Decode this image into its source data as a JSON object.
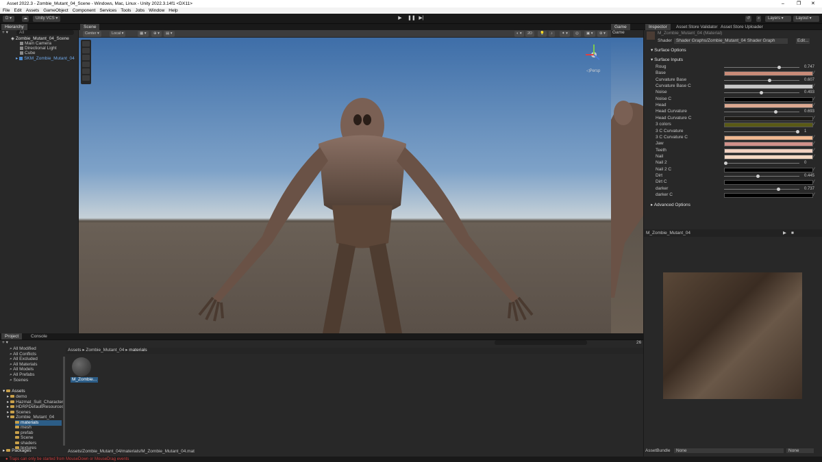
{
  "window": {
    "title": "Asset 2022.3 - Zombie_Mutant_04_Scene - Windows, Mac, Linux - Unity 2022.3.14f1 <DX11>"
  },
  "menu": [
    "File",
    "Edit",
    "Assets",
    "GameObject",
    "Component",
    "Services",
    "Tools",
    "Jobs",
    "Window",
    "Help"
  ],
  "toolbar": {
    "account": "D",
    "vcs": "Unity VCS",
    "layers": "Layers",
    "layout": "Layout"
  },
  "hierarchy": {
    "tab": "Hierarchy",
    "search_placeholder": "All",
    "scene": "Zombie_Mutant_04_Scene",
    "items": [
      "Main Camera",
      "Directional Light",
      "Cube",
      "SKM_Zombie_Mutant_04"
    ]
  },
  "scene": {
    "tab": "Scene",
    "pivot": "Center",
    "space": "Local",
    "persp": "Persp",
    "mode": "2D"
  },
  "game": {
    "tab": "Game",
    "display": "Game"
  },
  "inspector": {
    "tabs": [
      "Inspector",
      "Asset Store Validator",
      "Asset Store Uploader"
    ],
    "material": "M_Zombie_Mutant_04 (Material)",
    "shader_label": "Shader",
    "shader": "Shader Graphs/Zombie_Mutant_04 Shader Graph",
    "edit": "Edit...",
    "surface_options": "Surface Options",
    "surface_inputs": "Surface Inputs",
    "advanced": "Advanced Options",
    "props": [
      {
        "name": "Roug",
        "type": "slider",
        "value": "0.747",
        "v": 0.747
      },
      {
        "name": "Base",
        "type": "color",
        "color": "#c98b78"
      },
      {
        "name": "Curvature Base",
        "type": "slider",
        "value": "0.607",
        "v": 0.607
      },
      {
        "name": "Curvature Base C",
        "type": "color",
        "color": "#c8c8c8"
      },
      {
        "name": "Noise",
        "type": "slider",
        "value": "0.493",
        "v": 0.493
      },
      {
        "name": "Noise C",
        "type": "color",
        "color": "#000000"
      },
      {
        "name": "Head",
        "type": "color",
        "color": "#dca890"
      },
      {
        "name": "Head Curvature",
        "type": "slider",
        "value": "0.693",
        "v": 0.693
      },
      {
        "name": "Head Curvature C",
        "type": "color",
        "color": "#1c1a16"
      },
      {
        "name": "3 colors",
        "type": "color",
        "color": "#5a5a16"
      },
      {
        "name": "3 C Curvature",
        "type": "slider",
        "value": "1",
        "v": 1
      },
      {
        "name": "3 C Curvature C",
        "type": "color",
        "color": "#f0b890"
      },
      {
        "name": "Jaw",
        "type": "color",
        "color": "#d0908a"
      },
      {
        "name": "Teeth",
        "type": "color",
        "color": "#f0d0c0"
      },
      {
        "name": "Nail",
        "type": "color",
        "color": "#f4d8c4"
      },
      {
        "name": "Nail 2",
        "type": "slider",
        "value": "0",
        "v": 0
      },
      {
        "name": "Nail 2 C",
        "type": "color",
        "color": "#000000"
      },
      {
        "name": "Dirt",
        "type": "slider",
        "value": "0.445",
        "v": 0.445
      },
      {
        "name": "Dirt C",
        "type": "color",
        "color": "#000000"
      },
      {
        "name": "darker",
        "type": "slider",
        "value": "0.737",
        "v": 0.737
      },
      {
        "name": "darker C",
        "type": "color",
        "color": "#000000"
      }
    ],
    "preview_title": "M_Zombie_Mutant_04",
    "assetbundle_label": "AssetBundle",
    "assetbundle": "None",
    "variant": "None"
  },
  "project": {
    "tabs": [
      "Project",
      "Console"
    ],
    "favorites": [
      "All Modified",
      "All Conflicts",
      "All Excluded",
      "All Materials",
      "All Models",
      "All Prefabs",
      "Scenes"
    ],
    "assets_root": "Assets",
    "assets": [
      "demo",
      "Hazmat_Suit_Character",
      "HDRPDefaultResources",
      "Scenes",
      "Zombie_Mutant_04"
    ],
    "zombie_children": [
      "materials",
      "mesh",
      "prefab",
      "Scene",
      "shaders",
      "textures"
    ],
    "packages": "Packages",
    "breadcrumb": [
      "Assets",
      "Zombie_Mutant_04",
      "materials"
    ],
    "asset_tile": "M_Zombie...",
    "path": "Assets/Zombie_Mutant_04/materials/M_Zombie_Mutant_04.mat",
    "count": "26"
  },
  "status": {
    "message": "Traps can only be started from MouseDown or MouseDrag events"
  }
}
